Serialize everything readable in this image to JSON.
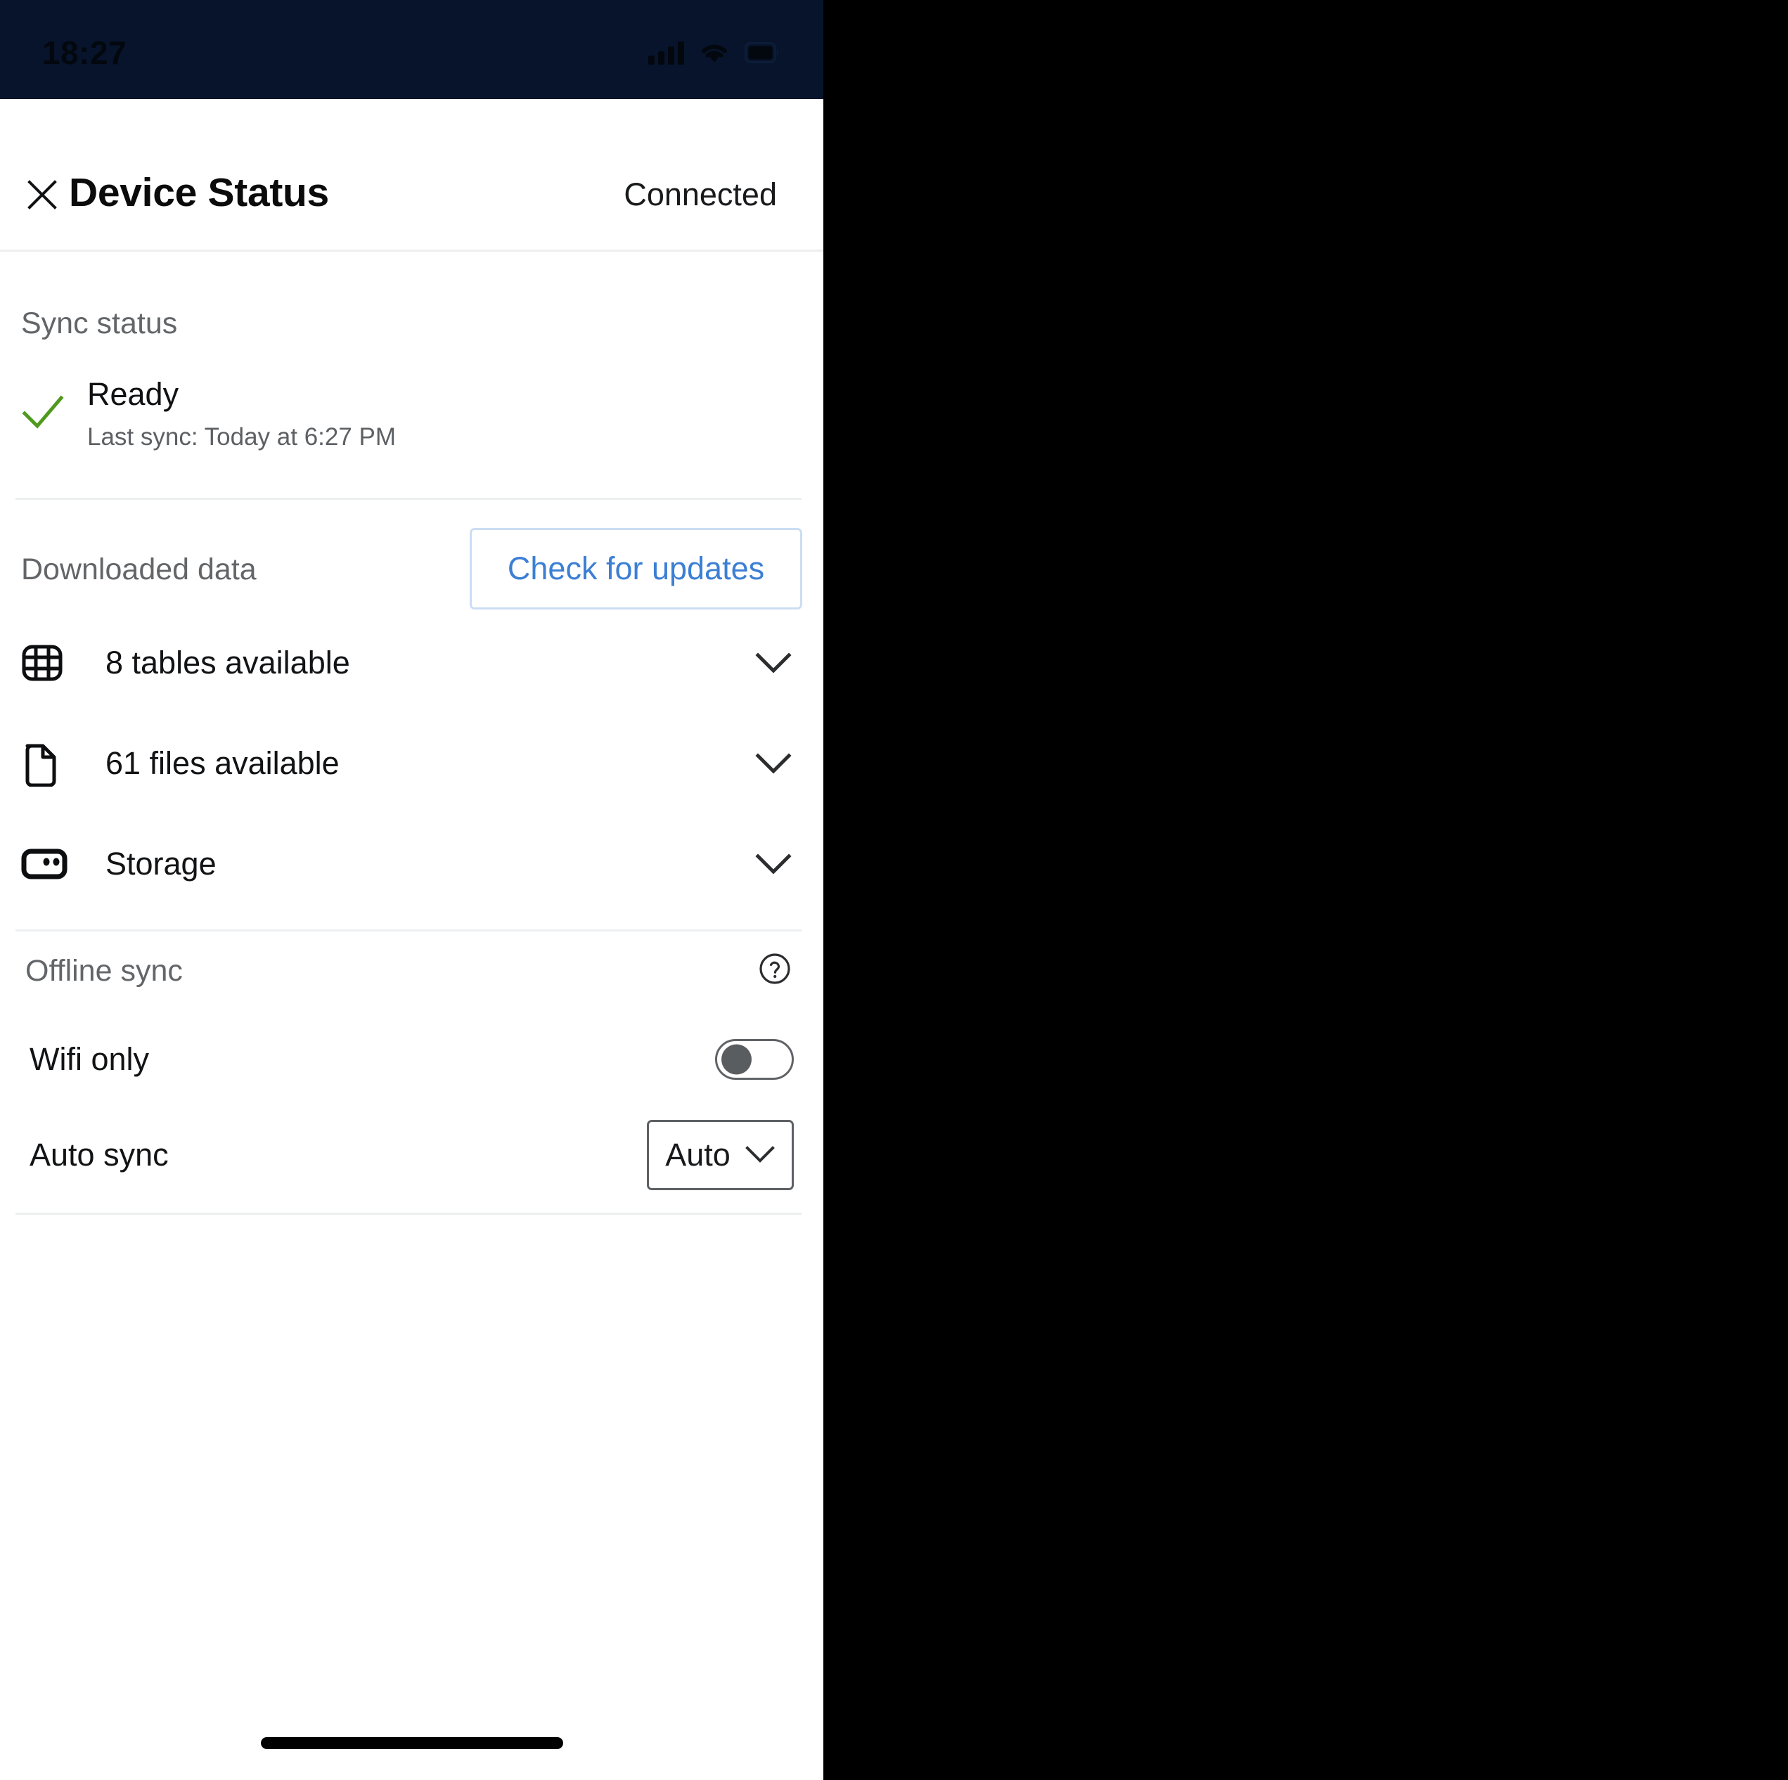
{
  "status_bar": {
    "time": "18:27",
    "icons": [
      "cellular-signal-icon",
      "wifi-icon",
      "battery-icon"
    ]
  },
  "header": {
    "close_icon": "close-icon",
    "title": "Device Status",
    "connection_status": "Connected"
  },
  "sync_section": {
    "heading": "Sync status",
    "status_icon": "checkmark-icon",
    "status_color": "#4f9a1e",
    "state": "Ready",
    "last_sync": "Last sync: Today at 6:27 PM"
  },
  "downloaded_data": {
    "heading": "Downloaded data",
    "check_updates_label": "Check for updates",
    "accent_color": "#3c7fd4",
    "rows": [
      {
        "icon": "table-grid-icon",
        "label": "8 tables available",
        "chevron": "chevron-down-icon"
      },
      {
        "icon": "file-document-icon",
        "label": "61 files available",
        "chevron": "chevron-down-icon"
      },
      {
        "icon": "storage-drive-icon",
        "label": "Storage",
        "chevron": "chevron-down-icon"
      }
    ]
  },
  "offline_sync": {
    "heading": "Offline sync",
    "help_icon": "help-circle-icon",
    "wifi_only": {
      "label": "Wifi only",
      "toggle_state": "off"
    },
    "auto_sync": {
      "label": "Auto sync",
      "value": "Auto",
      "chevron": "chevron-down-icon"
    }
  },
  "system": {
    "home_indicator": "home-indicator"
  },
  "colors": {
    "status_bar_bg": "#07142c",
    "page_bg": "#ffffff",
    "divider": "#eceef0",
    "muted_text": "#636669",
    "primary_text": "#121315"
  }
}
